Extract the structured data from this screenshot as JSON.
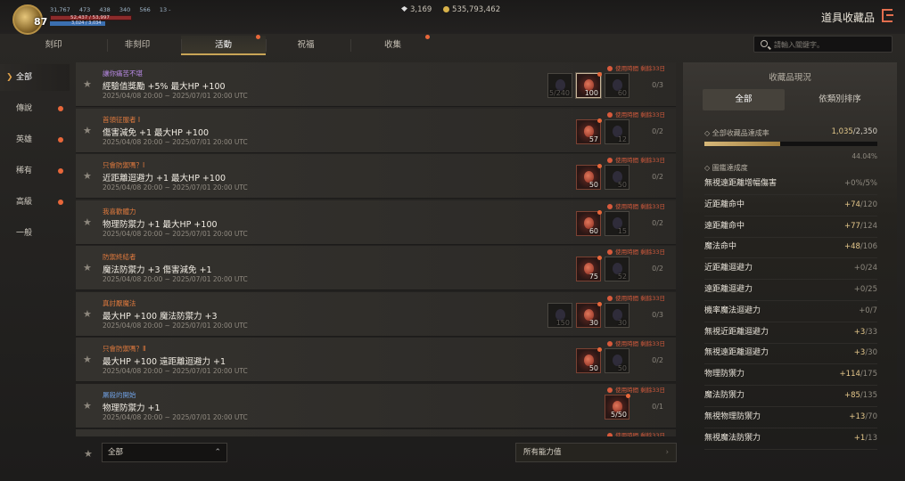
{
  "header": {
    "level": "87",
    "stats": [
      "31,767",
      "473",
      "438",
      "340",
      "566",
      "13 -"
    ],
    "hp": "52,437 / 53,997",
    "mp": "3,024 / 3,034",
    "gems": "3,169",
    "gold": "535,793,462",
    "title": "道具收藏品"
  },
  "tabs": [
    {
      "label": "刻印",
      "dot": false
    },
    {
      "label": "非刻印",
      "dot": false
    },
    {
      "label": "活動",
      "dot": true,
      "active": true
    },
    {
      "label": "祝福",
      "dot": false
    },
    {
      "label": "收集",
      "dot": true
    }
  ],
  "search": {
    "placeholder": "請輸入關鍵字。"
  },
  "sidebar": [
    {
      "label": "全部",
      "active": true,
      "dot": false
    },
    {
      "label": "傳說",
      "dot": true
    },
    {
      "label": "英雄",
      "dot": true
    },
    {
      "label": "稀有",
      "dot": true
    },
    {
      "label": "高級",
      "dot": true
    },
    {
      "label": "一般",
      "dot": false
    }
  ],
  "items": [
    {
      "tag": "讓你痛苦不堪",
      "tag_color": "#b98ae6",
      "effect": "經驗值獎勵 +5% 最大HP +100",
      "date": "2025/04/08 20:00 ~ 2025/07/01 20:00 UTC",
      "timer": "使用時間 剩餘33日",
      "slots": [
        {
          "n": "5/240",
          "state": "dim"
        },
        {
          "n": "100",
          "state": "owned",
          "selected": true,
          "dot": true
        },
        {
          "n": "60",
          "state": "dim"
        }
      ],
      "frac": "0/3"
    },
    {
      "tag": "首領征服者 Ⅰ",
      "tag_color": "#e07a3e",
      "effect": "傷害減免 +1 最大HP +100",
      "date": "2025/04/08 20:00 ~ 2025/07/01 20:00 UTC",
      "timer": "使用時間 剩餘33日",
      "slots": [
        {
          "n": "57",
          "state": "owned",
          "dot": true
        },
        {
          "n": "12",
          "state": "dim"
        }
      ],
      "frac": "0/2"
    },
    {
      "tag": "只會防禦嗎？Ⅰ",
      "tag_color": "#e07a3e",
      "effect": "近距離迴避力 +1 最大HP +100",
      "date": "2025/04/08 20:00 ~ 2025/07/01 20:00 UTC",
      "timer": "使用時間 剩餘33日",
      "slots": [
        {
          "n": "50",
          "state": "owned",
          "dot": true
        },
        {
          "n": "50",
          "state": "dim"
        }
      ],
      "frac": "0/2"
    },
    {
      "tag": "我喜歡體力",
      "tag_color": "#e07a3e",
      "effect": "物理防禦力 +1 最大HP +100",
      "date": "2025/04/08 20:00 ~ 2025/07/01 20:00 UTC",
      "timer": "使用時間 剩餘33日",
      "slots": [
        {
          "n": "60",
          "state": "owned",
          "dot": true
        },
        {
          "n": "15",
          "state": "dim"
        }
      ],
      "frac": "0/2"
    },
    {
      "tag": "防禦終結者",
      "tag_color": "#e07a3e",
      "effect": "魔法防禦力 +3 傷害減免 +1",
      "date": "2025/04/08 20:00 ~ 2025/07/01 20:00 UTC",
      "timer": "使用時間 剩餘33日",
      "slots": [
        {
          "n": "75",
          "state": "owned",
          "dot": true
        },
        {
          "n": "52",
          "state": "dim"
        }
      ],
      "frac": "0/2"
    },
    {
      "tag": "真討厭魔法",
      "tag_color": "#e07a3e",
      "effect": "最大HP +100 魔法防禦力 +3",
      "date": "2025/04/08 20:00 ~ 2025/07/01 20:00 UTC",
      "timer": "使用時間 剩餘33日",
      "slots": [
        {
          "n": "150",
          "state": "dim"
        },
        {
          "n": "30",
          "state": "owned",
          "dot": true
        },
        {
          "n": "30",
          "state": "dim"
        }
      ],
      "frac": "0/3"
    },
    {
      "tag": "只會防禦嗎？Ⅱ",
      "tag_color": "#e07a3e",
      "effect": "最大HP +100 遠距離迴避力 +1",
      "date": "2025/04/08 20:00 ~ 2025/07/01 20:00 UTC",
      "timer": "使用時間 剩餘33日",
      "slots": [
        {
          "n": "50",
          "state": "owned",
          "dot": true
        },
        {
          "n": "50",
          "state": "dim"
        }
      ],
      "frac": "0/2"
    },
    {
      "tag": "屠殺的開始",
      "tag_color": "#6f9fe0",
      "effect": "物理防禦力 +1",
      "date": "2025/04/08 20:00 ~ 2025/07/01 20:00 UTC",
      "timer": "使用時間 剩餘33日",
      "slots": [
        {
          "n": "5/50",
          "state": "owned",
          "dot": true
        }
      ],
      "frac": "0/1"
    },
    {
      "tag": "",
      "tag_color": "#e07a3e",
      "effect": "",
      "date": "",
      "timer": "使用時間 剩餘33日",
      "slots": [],
      "frac": ""
    }
  ],
  "bottom": {
    "filter": "全部",
    "all_stats": "所有能力值"
  },
  "panel": {
    "title": "收藏品現況",
    "tab_all": "全部",
    "tab_sort": "依類別排序",
    "total_label": "◇ 全部收藏品達成率",
    "total_value": "1,035",
    "total_max": "/2,350",
    "progress": 0.4404,
    "percent": "44.04%",
    "section": "◇ 圖鑑達成度",
    "stats": [
      {
        "name": "無視遠距離增幅傷害",
        "value": "+0%",
        "max": "/5%",
        "color": "#8e897f"
      },
      {
        "name": "近距離命中",
        "value": "+74",
        "max": "/120",
        "color": "#e7c98c"
      },
      {
        "name": "遠距離命中",
        "value": "+77",
        "max": "/124",
        "color": "#e7c98c"
      },
      {
        "name": "魔法命中",
        "value": "+48",
        "max": "/106",
        "color": "#e7c98c"
      },
      {
        "name": "近距離迴避力",
        "value": "+0",
        "max": "/24",
        "color": "#8e897f"
      },
      {
        "name": "遠距離迴避力",
        "value": "+0",
        "max": "/25",
        "color": "#8e897f"
      },
      {
        "name": "機率魔法迴避力",
        "value": "+0",
        "max": "/7",
        "color": "#8e897f"
      },
      {
        "name": "無視近距離迴避力",
        "value": "+3",
        "max": "/33",
        "color": "#e7c98c"
      },
      {
        "name": "無視遠距離迴避力",
        "value": "+3",
        "max": "/30",
        "color": "#e7c98c"
      },
      {
        "name": "物理防禦力",
        "value": "+114",
        "max": "/175",
        "color": "#e7c98c"
      },
      {
        "name": "魔法防禦力",
        "value": "+85",
        "max": "/135",
        "color": "#e7c98c"
      },
      {
        "name": "無視物理防禦力",
        "value": "+13",
        "max": "/70",
        "color": "#e7c98c"
      },
      {
        "name": "無視魔法防禦力",
        "value": "+1",
        "max": "/13",
        "color": "#e7c98c"
      }
    ]
  }
}
